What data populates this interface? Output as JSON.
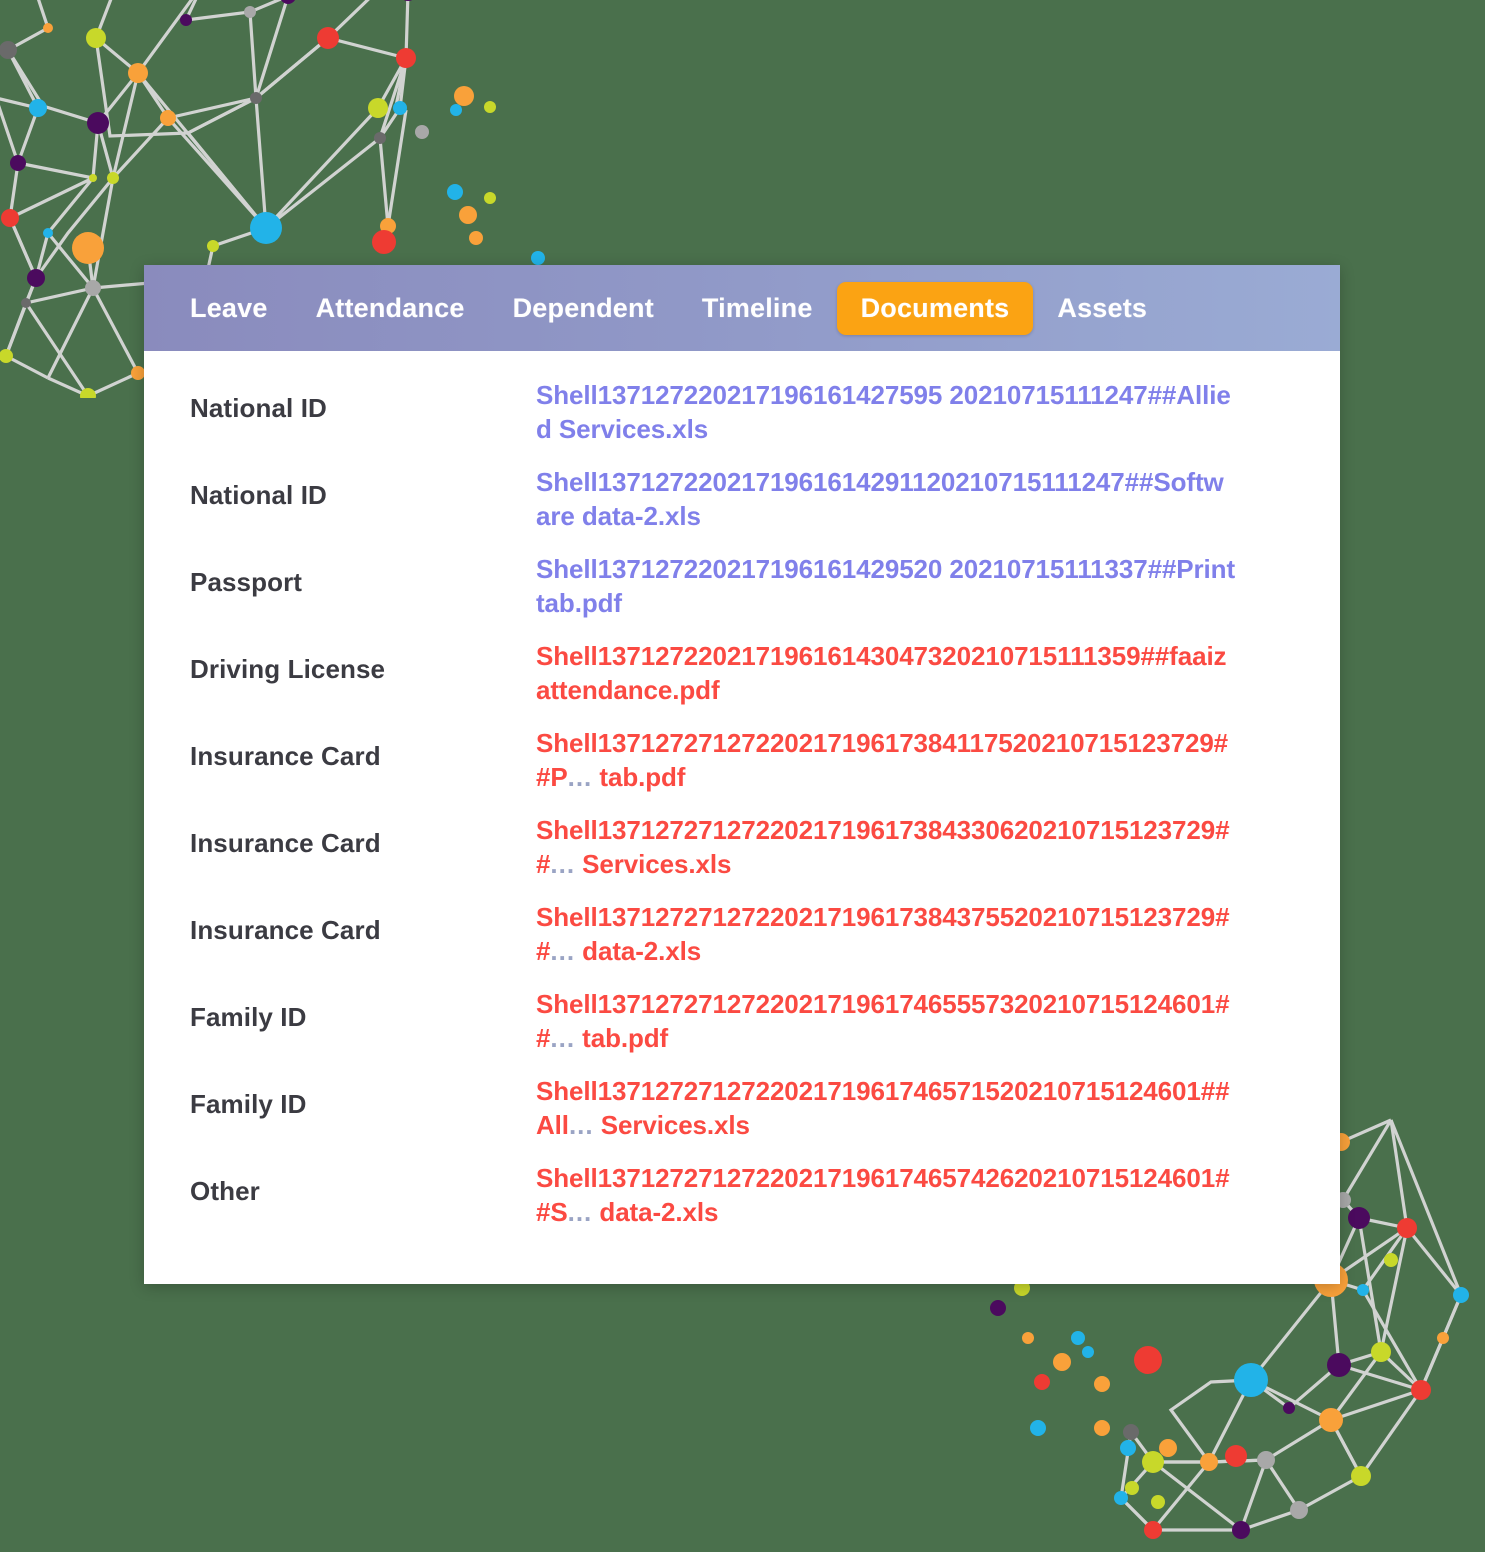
{
  "page": {
    "background_color": "#4a704c",
    "card_background": "#ffffff"
  },
  "tabbar": {
    "gradient_from": "#8a8bbd",
    "gradient_to": "#9aabd4",
    "active_tab_color": "#fba313",
    "tabs": [
      {
        "label": "Leave",
        "active": false
      },
      {
        "label": "Attendance",
        "active": false
      },
      {
        "label": "Dependent",
        "active": false
      },
      {
        "label": "Timeline",
        "active": false
      },
      {
        "label": "Documents",
        "active": true
      },
      {
        "label": "Assets",
        "active": false
      }
    ]
  },
  "documents": {
    "violet_link_color": "#8080ea",
    "red_link_color": "#fb4a42",
    "rows": [
      {
        "type": "National ID",
        "filename": "Shell137127220217196161427595 20210715111247##Allied Services.xls",
        "color": "violet",
        "truncated": false
      },
      {
        "type": "National ID",
        "filename": "Shell1371272202171961614291120210715111247##Software data-2.xls",
        "color": "violet",
        "truncated": false
      },
      {
        "type": "Passport",
        "filename": "Shell137127220217196161429520 20210715111337##Print tab.pdf",
        "color": "violet",
        "truncated": false
      },
      {
        "type": "Driving License",
        "filename": "Shell13712722021719616143047320210715111359##faaiz attendance.pdf",
        "color": "red",
        "truncated": false
      },
      {
        "type": "Insurance Card",
        "filename": "Shell1371272712722021719617384117520210715123729##P",
        "suffix": "tab.pdf",
        "color": "red",
        "truncated": true
      },
      {
        "type": "Insurance Card",
        "filename": "Shell1371272712722021719617384330620210715123729##",
        "suffix": "Services.xls",
        "color": "red",
        "truncated": true
      },
      {
        "type": "Insurance Card",
        "filename": "Shell1371272712722021719617384375520210715123729##",
        "suffix": "data-2.xls",
        "color": "red",
        "truncated": true
      },
      {
        "type": "Family ID",
        "filename": "Shell1371272712722021719617465557320210715124601##",
        "suffix": "tab.pdf",
        "color": "red",
        "truncated": true
      },
      {
        "type": "Family ID",
        "filename": "Shell137127271272202171961746571520210715124601##All",
        "suffix": "Services.xls",
        "color": "red",
        "truncated": true
      },
      {
        "type": "Other",
        "filename": "Shell1371272712722021719617465742620210715124601##S",
        "suffix": "data-2.xls",
        "color": "red",
        "truncated": true
      }
    ],
    "truncation_marker": "..."
  },
  "decoration": {
    "name": "network-graph",
    "edge_color": "#d8d8d8",
    "node_colors": [
      "#ee3b33",
      "#22b3e8",
      "#f9a13a",
      "#4b0a5e",
      "#c8d82a",
      "#6a6a6a",
      "#3b3b3b"
    ]
  }
}
